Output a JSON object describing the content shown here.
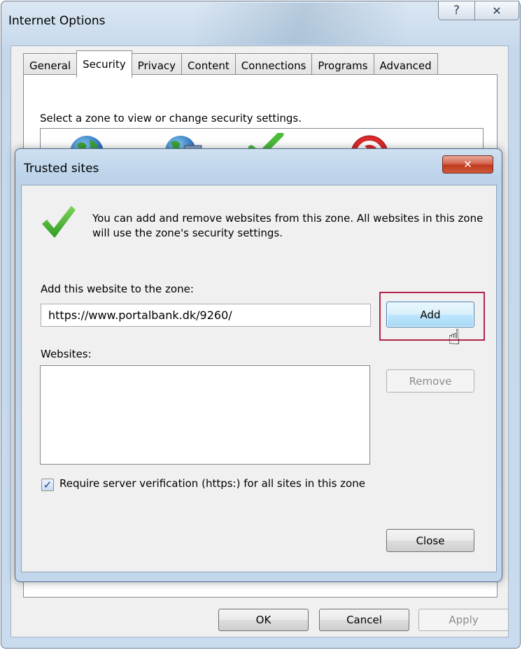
{
  "outer_window": {
    "title": "Internet Options",
    "help_icon": "help-icon",
    "close_icon": "close-icon",
    "tabs": [
      {
        "label": "General",
        "active": false
      },
      {
        "label": "Security",
        "active": true
      },
      {
        "label": "Privacy",
        "active": false
      },
      {
        "label": "Content",
        "active": false
      },
      {
        "label": "Connections",
        "active": false
      },
      {
        "label": "Programs",
        "active": false
      },
      {
        "label": "Advanced",
        "active": false
      }
    ],
    "zone_prompt": "Select a zone to view or change security settings.",
    "zones": [
      {
        "icon": "internet-globe-icon"
      },
      {
        "icon": "local-intranet-icon"
      },
      {
        "icon": "trusted-sites-check-icon"
      },
      {
        "icon": "restricted-sites-icon"
      }
    ],
    "buttons": {
      "ok": "OK",
      "cancel": "Cancel",
      "apply": "Apply"
    }
  },
  "dialog": {
    "title": "Trusted sites",
    "close_icon": "close-icon",
    "info_icon": "green-checkmark-icon",
    "info_text": "You can add and remove websites from this zone. All websites in this zone will use the zone's security settings.",
    "add_label": "Add this website to the zone:",
    "url_value": "https://www.portalbank.dk/9260/",
    "add_button": "Add",
    "websites_label": "Websites:",
    "websites": [],
    "remove_button": "Remove",
    "require_https_label": "Require server verification (https:) for all sites in this zone",
    "require_https_checked": true,
    "close_button": "Close"
  },
  "colors": {
    "highlight_border": "#b0254b",
    "title_bar": "#c3d7ec",
    "checkmark_green": "#3fae2a"
  }
}
